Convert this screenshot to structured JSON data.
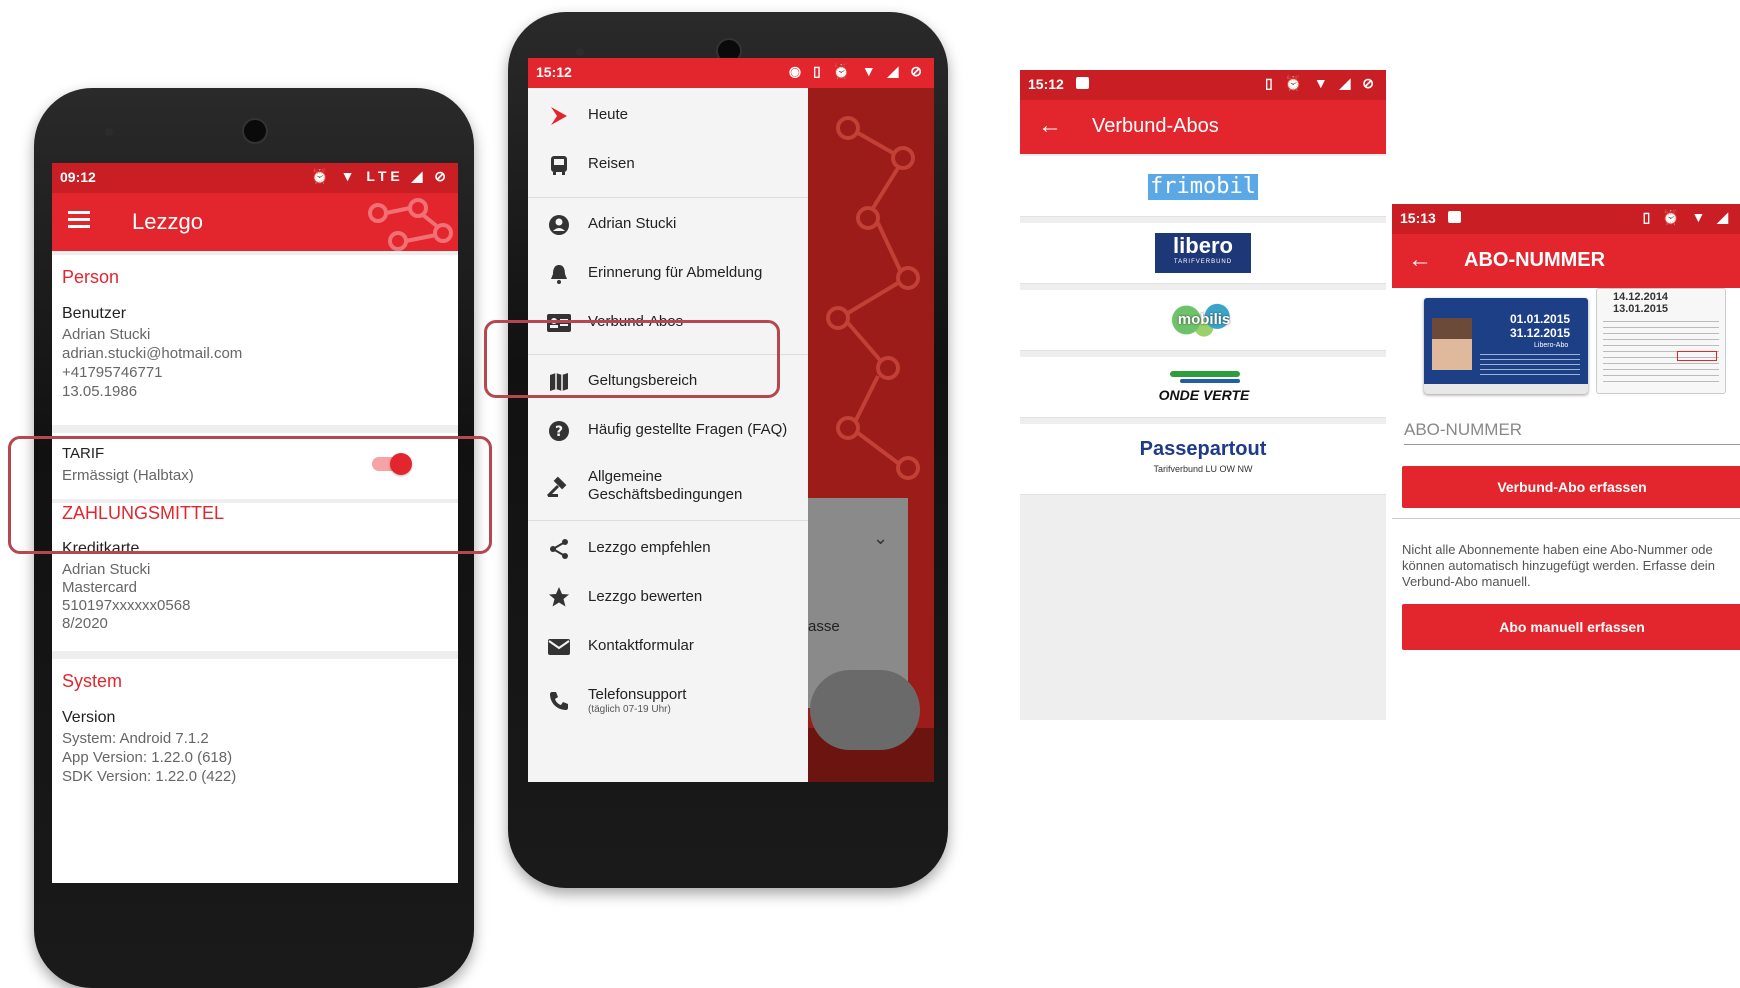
{
  "phone1": {
    "status_time": "09:12",
    "status_icons": "⏰ ▼ LTE ◢ ⊘",
    "title": "Lezzgo",
    "person": {
      "heading": "Person",
      "label": "Benutzer",
      "lines": [
        "Adrian Stucki",
        "adrian.stucki@hotmail.com",
        "+41795746771",
        "13.05.1986"
      ]
    },
    "tarif": {
      "label": "TARIF",
      "value": "Ermässigt (Halbtax)",
      "toggle_on": true
    },
    "payment": {
      "heading": "ZAHLUNGSMITTEL",
      "label": "Kreditkarte",
      "lines": [
        "Adrian Stucki",
        "Mastercard",
        "510197xxxxxx0568",
        "8/2020"
      ]
    },
    "system": {
      "heading": "System",
      "label": "Version",
      "lines": [
        "System: Android 7.1.2",
        "App Version: 1.22.0 (618)",
        "SDK Version: 1.22.0 (422)"
      ]
    }
  },
  "phone2": {
    "status_time": "15:12",
    "status_icons": "◉ ▯ ⏰ ▼ ◢ ⊘",
    "menu": [
      {
        "label": "Heute",
        "icon": "arrow-icon"
      },
      {
        "label": "Reisen",
        "icon": "bus-icon"
      },
      {
        "label": "Adrian Stucki",
        "icon": "account-icon"
      },
      {
        "label": "Erinnerung für Abmeldung",
        "icon": "bell-icon"
      },
      {
        "label": "Verbund-Abos",
        "icon": "card-icon"
      },
      {
        "label": "Geltungsbereich",
        "icon": "map-icon"
      },
      {
        "label": "Häufig gestellte Fragen (FAQ)",
        "icon": "help-icon"
      },
      {
        "label": "Allgemeine",
        "label2": "Geschäftsbedingungen",
        "icon": "gavel-icon"
      },
      {
        "label": "Lezzgo empfehlen",
        "icon": "share-icon"
      },
      {
        "label": "Lezzgo bewerten",
        "icon": "star-icon"
      },
      {
        "label": "Kontaktformular",
        "icon": "mail-icon"
      },
      {
        "label": "Telefonsupport",
        "label2": "(täglich 07-19 Uhr)",
        "icon": "phone-icon"
      }
    ],
    "behind_text": "asse"
  },
  "screen3": {
    "status_time": "15:12",
    "status_icons": "▯ ⏰ ▼ ◢ ⊘",
    "title": "Verbund-Abos",
    "logos": [
      "frimobil",
      "libero",
      "mobilis",
      "ONDE VERTE",
      "Passepartout"
    ],
    "libero_sub": "TARIFVERBUND",
    "passepartout_sub": "Tarifverbund LU OW NW"
  },
  "screen4": {
    "status_time": "15:13",
    "status_icons": "▯ ⏰ ▼ ◢",
    "title": "ABO-NUMMER",
    "card_dates": [
      "01.01.2015",
      "31.12.2015"
    ],
    "card_dates2": [
      "14.12.2014",
      "13.01.2015"
    ],
    "card_label": "Libero-Abo",
    "input_placeholder": "ABO-NUMMER",
    "button1": "Verbund-Abo erfassen",
    "info_lines": [
      "Nicht alle Abonnemente haben eine Abo-Nummer ode",
      "können automatisch hinzugefügt werden. Erfasse dein",
      "Verbund-Abo manuell."
    ],
    "button2": "Abo manuell erfassen"
  },
  "colors": {
    "brand_red": "#e3262d",
    "highlight": "#b5474f"
  }
}
